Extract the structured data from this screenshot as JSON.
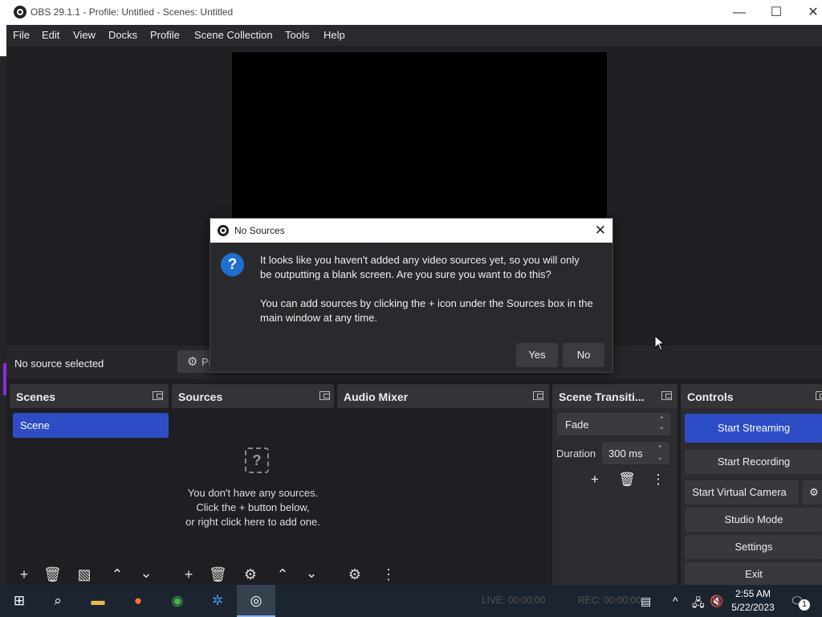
{
  "window": {
    "title": "OBS 29.1.1 - Profile: Untitled - Scenes: Untitled",
    "minimize": "—",
    "maximize": "☐",
    "close": "✕"
  },
  "menu": [
    "File",
    "Edit",
    "View",
    "Docks",
    "Profile",
    "Scene Collection",
    "Tools",
    "Help"
  ],
  "context": {
    "no_source": "No source selected",
    "properties_label": "Pr"
  },
  "docks": {
    "scenes": {
      "title": "Scenes",
      "items": [
        "Scene"
      ]
    },
    "sources": {
      "title": "Sources",
      "empty_line1": "You don't have any sources.",
      "empty_line2": "Click the + button below,",
      "empty_line3": "or right click here to add one."
    },
    "audio": {
      "title": "Audio Mixer"
    },
    "transitions": {
      "title": "Scene Transiti...",
      "selected": "Fade",
      "duration_label": "Duration",
      "duration_value": "300 ms"
    },
    "controls": {
      "title": "Controls",
      "start_streaming": "Start Streaming",
      "start_recording": "Start Recording",
      "start_virtual_camera": "Start Virtual Camera",
      "studio_mode": "Studio Mode",
      "settings": "Settings",
      "exit": "Exit"
    }
  },
  "dialog": {
    "title": "No Sources",
    "line1": "It looks like you haven't added any video sources yet, so you will only",
    "line2": "be outputting a blank screen. Are you sure you want to do this?",
    "line3": "You can add sources by clicking the + icon under the Sources box in the",
    "line4": "main window at any time.",
    "yes": "Yes",
    "no": "No"
  },
  "status": {
    "live": "LIVE: 00:00:00",
    "rec": "REC: 00:00:00"
  },
  "taskbar": {
    "time": "2:55 AM",
    "date": "5/22/2023",
    "notification_count": "1"
  }
}
